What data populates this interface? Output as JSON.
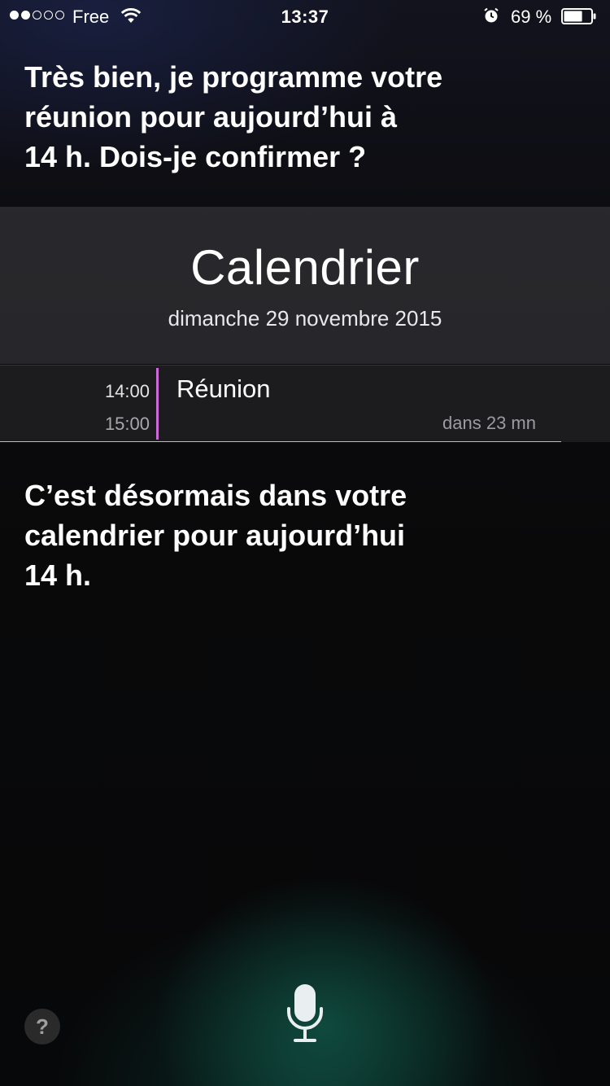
{
  "status_bar": {
    "signal_dots_filled": 2,
    "signal_dots_total": 5,
    "carrier": "Free",
    "time": "13:37",
    "battery_percent": "69 %",
    "battery_level": 0.69,
    "icons": [
      "wifi-icon",
      "alarm-icon",
      "battery-icon"
    ]
  },
  "siri": {
    "question_lines": [
      "Très bien, je programme votre",
      "réunion pour aujourd’hui à",
      "14 h. Dois-je confirmer ?"
    ],
    "answer_lines": [
      "C’est désormais dans votre",
      "calendrier pour aujourd’hui",
      "14 h."
    ]
  },
  "calendar": {
    "title": "Calendrier",
    "date": "dimanche 29 novembre 2015",
    "event": {
      "start": "14:00",
      "end": "15:00",
      "title": "Réunion",
      "relative": "dans 23 mn",
      "color": "#c96ad8"
    }
  },
  "controls": {
    "help_label": "?",
    "icons": [
      "question-icon",
      "microphone-icon"
    ]
  }
}
